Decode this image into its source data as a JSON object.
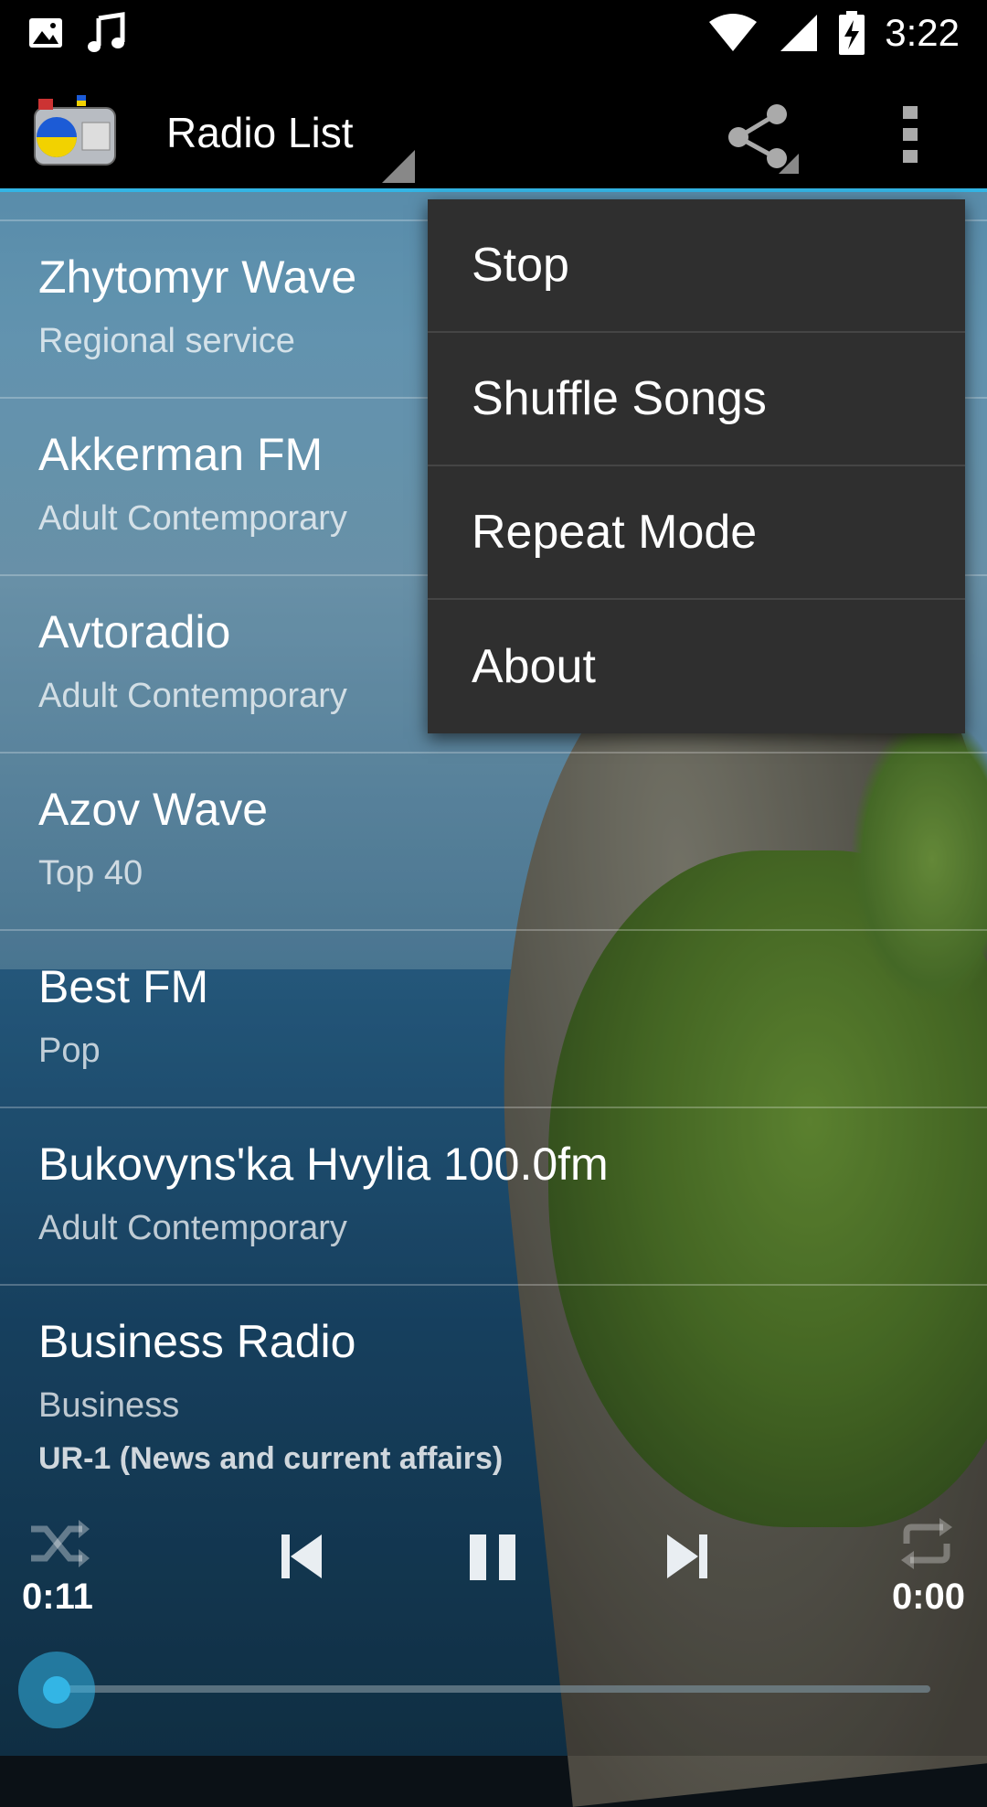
{
  "status_bar": {
    "time": "3:22",
    "left_icons": [
      "image-icon",
      "music-note-icon"
    ],
    "right_icons": [
      "wifi-icon",
      "signal-icon",
      "battery-charging-icon"
    ]
  },
  "action_bar": {
    "title": "Radio List",
    "icons": [
      "app-radio-icon",
      "share-icon",
      "overflow-menu-icon"
    ]
  },
  "stations": [
    {
      "name": "Zhytomyr Wave",
      "genre": "Regional service"
    },
    {
      "name": "Akkerman FM",
      "genre": "Adult Contemporary"
    },
    {
      "name": "Avtoradio",
      "genre": "Adult Contemporary"
    },
    {
      "name": "Azov Wave",
      "genre": "Top 40"
    },
    {
      "name": "Best FM",
      "genre": "Pop"
    },
    {
      "name": "Bukovyns'ka Hvylia 100.0fm",
      "genre": "Adult Contemporary"
    },
    {
      "name": "Business Radio",
      "genre": "Business"
    }
  ],
  "overflow_menu": {
    "items": [
      "Stop",
      "Shuffle Songs",
      "Repeat Mode",
      "About"
    ]
  },
  "player": {
    "now_playing": "UR-1 (News and current affairs)",
    "elapsed": "0:11",
    "duration": "0:00",
    "progress": 0,
    "controls": [
      "shuffle-icon",
      "previous-icon",
      "pause-icon",
      "next-icon",
      "repeat-icon"
    ]
  },
  "colors": {
    "accent": "#33b5e5",
    "menu_background": "#2f2f2f",
    "action_bar": "#000000"
  }
}
